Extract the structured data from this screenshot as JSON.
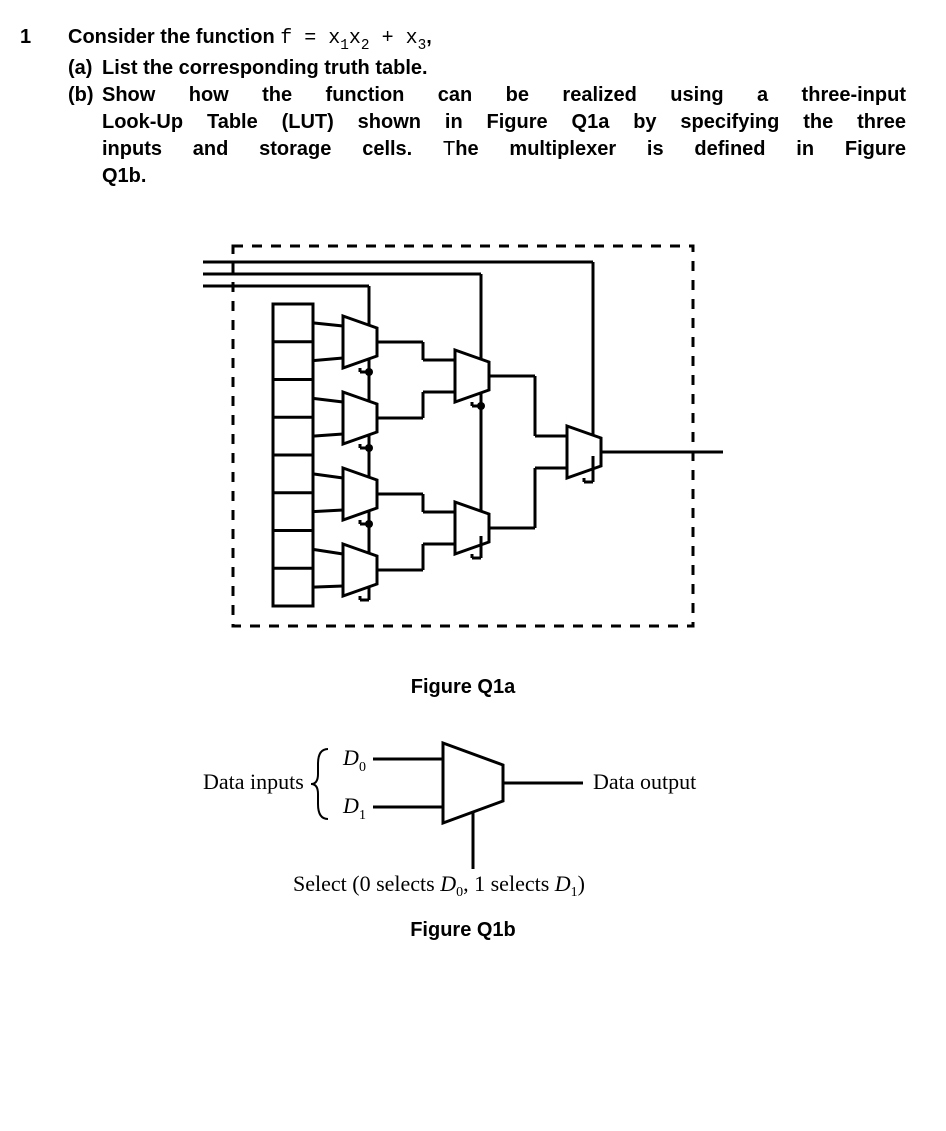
{
  "question": {
    "number": "1",
    "intro_prefix": "Consider the function ",
    "intro_func_sym": "f",
    "intro_eq": " = ",
    "intro_term1_x1": "x",
    "intro_term1_sub1": "1",
    "intro_term1_x2": "x",
    "intro_term1_sub2": "2",
    "intro_plus": " + ",
    "intro_term2_x3": "x",
    "intro_term2_sub3": "3",
    "intro_comma": ",",
    "part_a_label": "(a)",
    "part_a_text": "List the corresponding truth table.",
    "part_b_label": "(b)",
    "part_b_text_l1": "Show how the function can be realized using a three-input",
    "part_b_text_l2": "Look-Up Table (LUT) shown in Figure Q1a by specifying the three",
    "part_b_text_l3_a": "inputs and storage cells. ",
    "part_b_text_l3_b": "The multiplexer is defined in Figure",
    "part_b_text_l4": "Q1b."
  },
  "figQ1a": {
    "caption": "Figure Q1a"
  },
  "figQ1b": {
    "data_inputs_label": "Data inputs",
    "d0_label_letter": "D",
    "d0_label_sub": "0",
    "d1_label_letter": "D",
    "d1_label_sub": "1",
    "data_output_label": "Data output",
    "select_label_pre": "Select (0 selects ",
    "select_d0_letter": "D",
    "select_d0_sub": "0",
    "select_mid": ", 1 selects ",
    "select_d1_letter": "D",
    "select_d1_sub": "1",
    "select_close": ")",
    "caption": "Figure Q1b"
  }
}
